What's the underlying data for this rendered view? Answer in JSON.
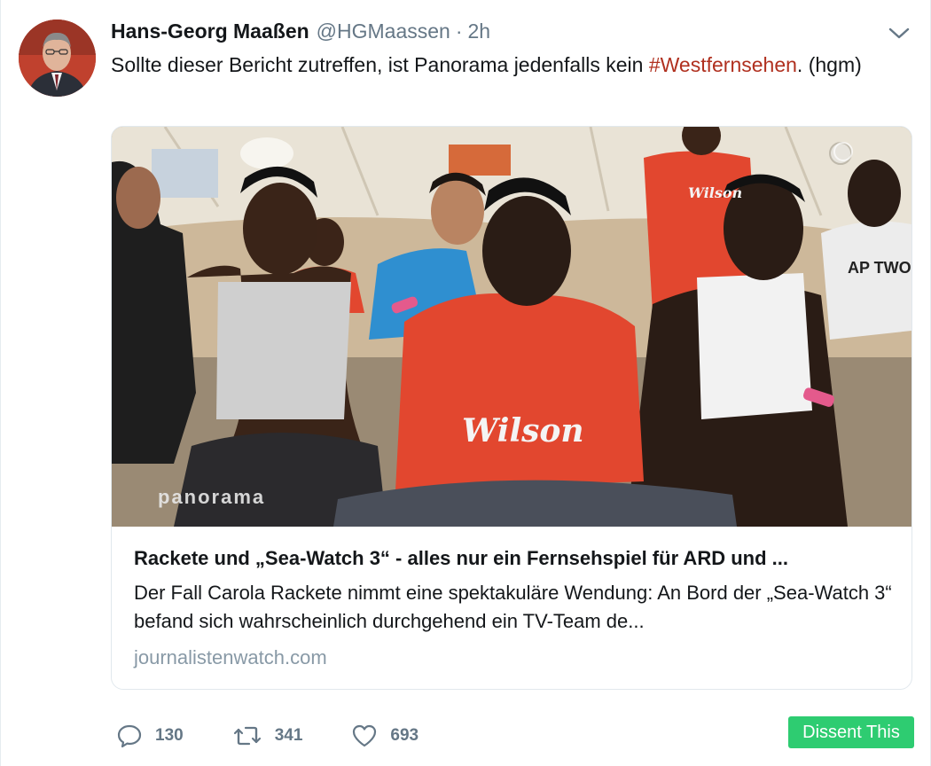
{
  "tweet": {
    "author_name": "Hans-Georg Maaßen",
    "handle": "@HGMaassen",
    "separator": "·",
    "time": "2h",
    "text_before": "Sollte dieser Bericht zutreffen, ist Panorama jedenfalls kein ",
    "hashtag": "#Westfernsehen",
    "text_after": ". (hgm)"
  },
  "card": {
    "title": "Rackete und „Sea-Watch 3“ - alles nur ein Fernsehspiel für ARD und ...",
    "description": "Der Fall Carola Rackete nimmt eine spektakuläre Wendung: An Bord der „Sea-Watch 3“ befand sich wahrscheinlich durchgehend ein TV-Team de...",
    "domain": "journalistenwatch.com",
    "image": {
      "watermark": "panorama",
      "shirt_text": "Wilson",
      "shirt_text_small": "Wilson",
      "shirt_text_back": "AP TWO"
    }
  },
  "actions": {
    "reply_icon": "reply-icon",
    "reply_count": "130",
    "retweet_icon": "retweet-icon",
    "retweet_count": "341",
    "like_icon": "heart-icon",
    "like_count": "693"
  },
  "dissent_button": "Dissent This",
  "colors": {
    "hashtag": "#b0301f",
    "muted": "#657786",
    "dissent": "#2ecc71"
  }
}
